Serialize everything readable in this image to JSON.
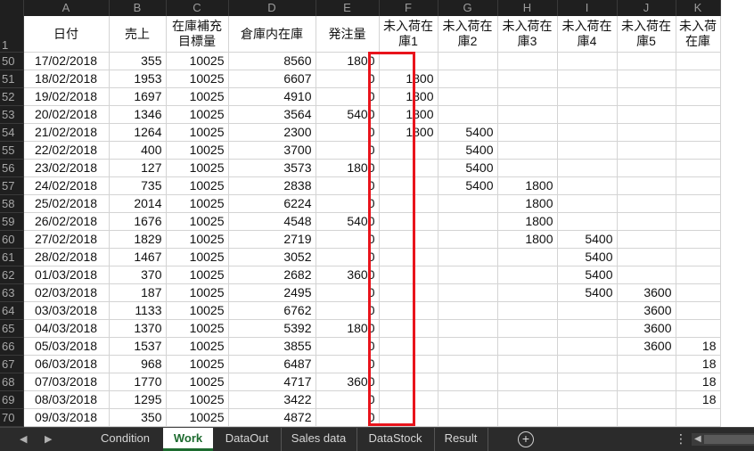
{
  "columns": [
    "A",
    "B",
    "C",
    "D",
    "E",
    "F",
    "G",
    "H",
    "I",
    "J",
    "K"
  ],
  "header_row_number": "1",
  "headers": [
    "日付",
    "売上",
    "在庫補充目標量",
    "倉庫内在庫",
    "発注量",
    "未入荷在庫1",
    "未入荷在庫2",
    "未入荷在庫3",
    "未入荷在庫4",
    "未入荷在庫5",
    "未入荷在庫"
  ],
  "rows": [
    {
      "n": "50",
      "c": [
        "17/02/2018",
        "355",
        "10025",
        "8560",
        "1800",
        "",
        "",
        "",
        "",
        "",
        ""
      ]
    },
    {
      "n": "51",
      "c": [
        "18/02/2018",
        "1953",
        "10025",
        "6607",
        "0",
        "1800",
        "",
        "",
        "",
        "",
        ""
      ]
    },
    {
      "n": "52",
      "c": [
        "19/02/2018",
        "1697",
        "10025",
        "4910",
        "0",
        "1800",
        "",
        "",
        "",
        "",
        ""
      ]
    },
    {
      "n": "53",
      "c": [
        "20/02/2018",
        "1346",
        "10025",
        "3564",
        "5400",
        "1800",
        "",
        "",
        "",
        "",
        ""
      ]
    },
    {
      "n": "54",
      "c": [
        "21/02/2018",
        "1264",
        "10025",
        "2300",
        "0",
        "1800",
        "5400",
        "",
        "",
        "",
        ""
      ]
    },
    {
      "n": "55",
      "c": [
        "22/02/2018",
        "400",
        "10025",
        "3700",
        "0",
        "",
        "5400",
        "",
        "",
        "",
        ""
      ]
    },
    {
      "n": "56",
      "c": [
        "23/02/2018",
        "127",
        "10025",
        "3573",
        "1800",
        "",
        "5400",
        "",
        "",
        "",
        ""
      ]
    },
    {
      "n": "57",
      "c": [
        "24/02/2018",
        "735",
        "10025",
        "2838",
        "0",
        "",
        "5400",
        "1800",
        "",
        "",
        ""
      ]
    },
    {
      "n": "58",
      "c": [
        "25/02/2018",
        "2014",
        "10025",
        "6224",
        "0",
        "",
        "",
        "1800",
        "",
        "",
        ""
      ]
    },
    {
      "n": "59",
      "c": [
        "26/02/2018",
        "1676",
        "10025",
        "4548",
        "5400",
        "",
        "",
        "1800",
        "",
        "",
        ""
      ]
    },
    {
      "n": "60",
      "c": [
        "27/02/2018",
        "1829",
        "10025",
        "2719",
        "0",
        "",
        "",
        "1800",
        "5400",
        "",
        ""
      ]
    },
    {
      "n": "61",
      "c": [
        "28/02/2018",
        "1467",
        "10025",
        "3052",
        "0",
        "",
        "",
        "",
        "5400",
        "",
        ""
      ]
    },
    {
      "n": "62",
      "c": [
        "01/03/2018",
        "370",
        "10025",
        "2682",
        "3600",
        "",
        "",
        "",
        "5400",
        "",
        ""
      ]
    },
    {
      "n": "63",
      "c": [
        "02/03/2018",
        "187",
        "10025",
        "2495",
        "0",
        "",
        "",
        "",
        "5400",
        "3600",
        ""
      ]
    },
    {
      "n": "64",
      "c": [
        "03/03/2018",
        "1133",
        "10025",
        "6762",
        "0",
        "",
        "",
        "",
        "",
        "3600",
        ""
      ]
    },
    {
      "n": "65",
      "c": [
        "04/03/2018",
        "1370",
        "10025",
        "5392",
        "1800",
        "",
        "",
        "",
        "",
        "3600",
        ""
      ]
    },
    {
      "n": "66",
      "c": [
        "05/03/2018",
        "1537",
        "10025",
        "3855",
        "0",
        "",
        "",
        "",
        "",
        "3600",
        "18"
      ]
    },
    {
      "n": "67",
      "c": [
        "06/03/2018",
        "968",
        "10025",
        "6487",
        "0",
        "",
        "",
        "",
        "",
        "",
        "18"
      ]
    },
    {
      "n": "68",
      "c": [
        "07/03/2018",
        "1770",
        "10025",
        "4717",
        "3600",
        "",
        "",
        "",
        "",
        "",
        "18"
      ]
    },
    {
      "n": "69",
      "c": [
        "08/03/2018",
        "1295",
        "10025",
        "3422",
        "0",
        "",
        "",
        "",
        "",
        "",
        "18"
      ]
    },
    {
      "n": "70",
      "c": [
        "09/03/2018",
        "350",
        "10025",
        "4872",
        "0",
        "",
        "",
        "",
        "",
        "",
        ""
      ]
    }
  ],
  "tabs": [
    {
      "label": "Condition",
      "active": false
    },
    {
      "label": "Work",
      "active": true
    },
    {
      "label": "DataOut",
      "active": false
    },
    {
      "label": "Sales data",
      "active": false
    },
    {
      "label": "DataStock",
      "active": false
    },
    {
      "label": "Result",
      "active": false
    }
  ],
  "nav": {
    "prev": "◀",
    "next": "▶"
  },
  "add_sheet": "+",
  "more": "⋮",
  "scroll_arrow": "◀",
  "colors": {
    "highlight": "#e8141c",
    "active_tab": "#1d6b2f",
    "header_bg": "#1f1f1f"
  }
}
